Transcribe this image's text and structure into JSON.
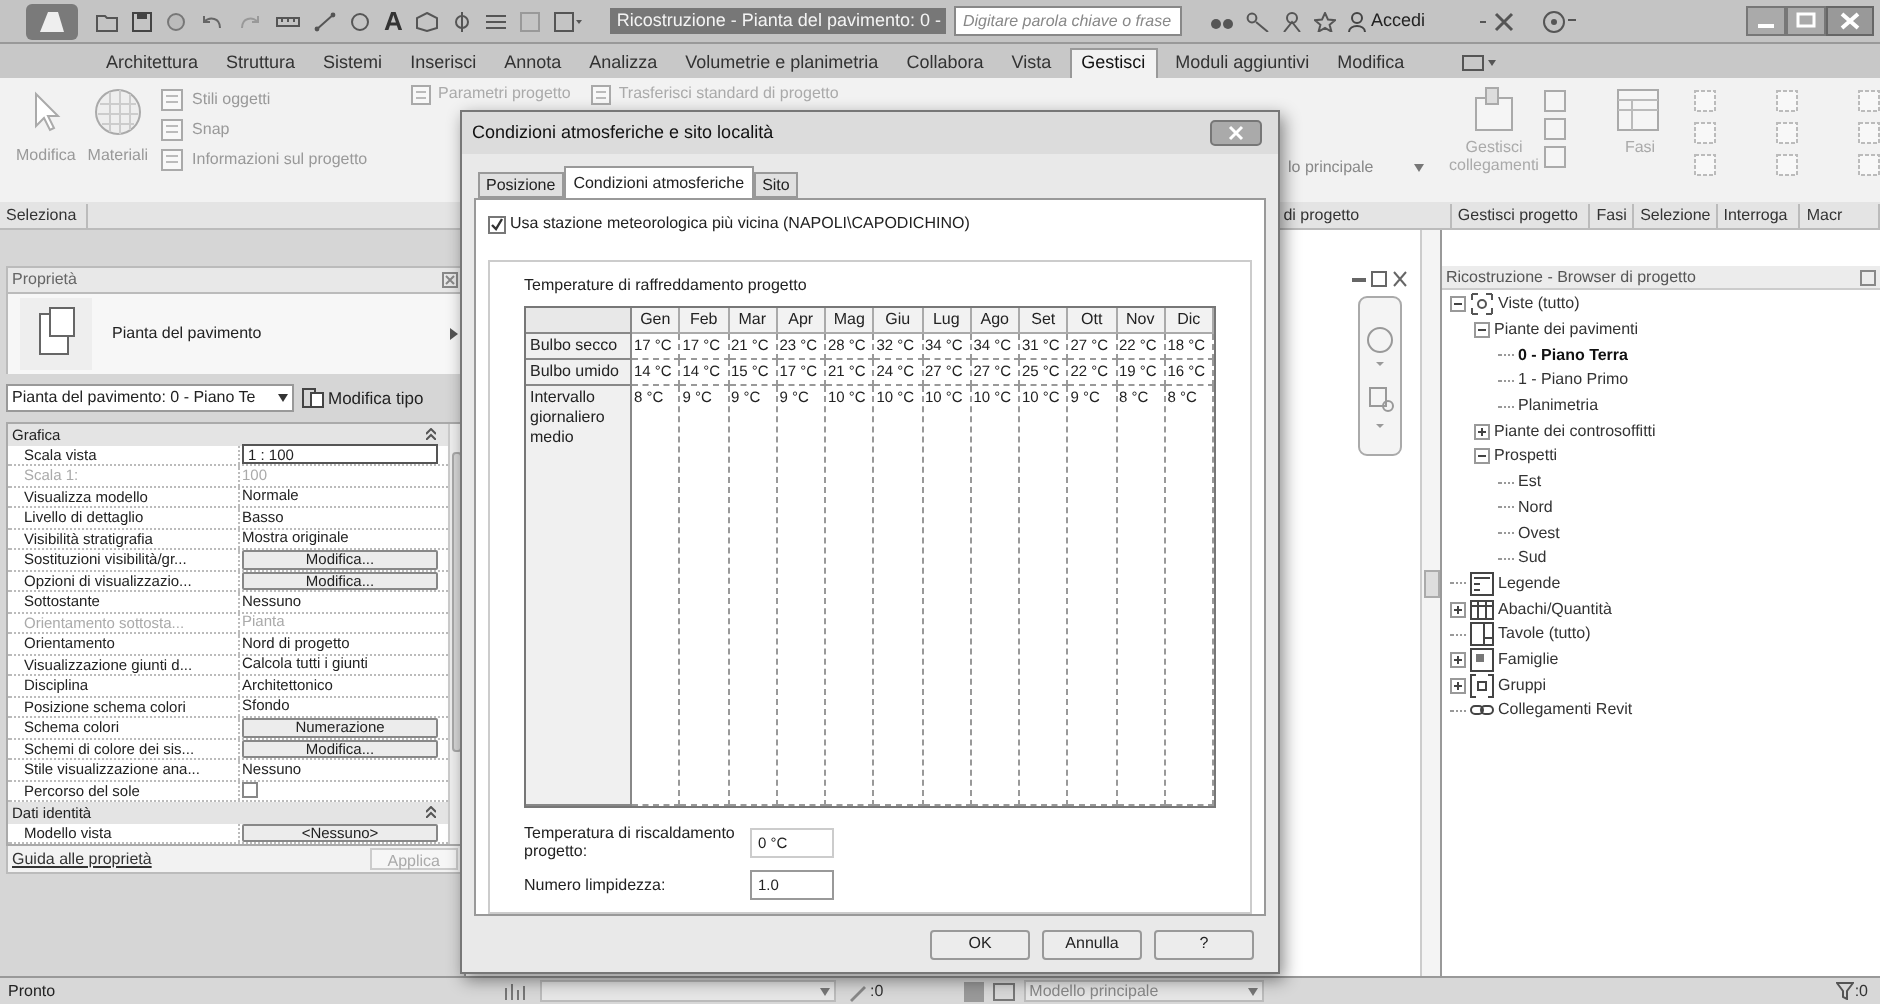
{
  "window": {
    "title": "Ricostruzione - Pianta del pavimento: 0 -"
  },
  "search": {
    "placeholder": "Digitare parola chiave o frase"
  },
  "sign_in": "Accedi",
  "quick_access": {
    "text_tool": "A"
  },
  "ribbon_tabs": [
    {
      "label": "Architettura",
      "selected": false
    },
    {
      "label": "Struttura",
      "selected": false
    },
    {
      "label": "Sistemi",
      "selected": false
    },
    {
      "label": "Inserisci",
      "selected": false
    },
    {
      "label": "Annota",
      "selected": false
    },
    {
      "label": "Analizza",
      "selected": false
    },
    {
      "label": "Volumetrie e planimetria",
      "selected": false
    },
    {
      "label": "Collabora",
      "selected": false
    },
    {
      "label": "Vista",
      "selected": false
    },
    {
      "label": "Gestisci",
      "selected": true
    },
    {
      "label": "Moduli aggiuntivi",
      "selected": false
    },
    {
      "label": "Modifica",
      "selected": false
    }
  ],
  "ribbon": {
    "large_buttons": [
      {
        "label": "Modifica",
        "kind": "select"
      },
      {
        "label": "Materiali",
        "kind": "materials"
      }
    ],
    "small_buttons": [
      "Stili oggetti",
      "Snap",
      "Informazioni sul progetto"
    ],
    "top_buttons": [
      "Parametri progetto",
      "Trasferisci standard di progetto"
    ],
    "dropdown": "lo principale",
    "right_buttons": [
      {
        "label": "Gestisci collegamenti",
        "kind": "links"
      },
      {
        "label": "Fasi",
        "kind": "phases"
      }
    ],
    "panel_label_left": "Seleziona",
    "panel_labels_right": [
      "di progetto",
      "Gestisci progetto",
      "Fasi",
      "Selezione",
      "Interroga",
      "Macr"
    ]
  },
  "properties": {
    "title": "Proprietà",
    "type_name": "Pianta del pavimento",
    "instance_selector": "Pianta del pavimento: 0 - Piano Te",
    "edit_type": "Modifica tipo",
    "groups": [
      {
        "label": "Grafica",
        "rows": [
          {
            "label": "Scala vista",
            "value": "1 : 100",
            "kind": "input",
            "disabled": false
          },
          {
            "label": "Scala 1:",
            "value": "100",
            "kind": "text",
            "disabled": true
          },
          {
            "label": "Visualizza modello",
            "value": "Normale",
            "kind": "text",
            "disabled": false
          },
          {
            "label": "Livello di dettaglio",
            "value": "Basso",
            "kind": "text",
            "disabled": false
          },
          {
            "label": "Visibilità stratigrafia",
            "value": "Mostra originale",
            "kind": "text",
            "disabled": false
          },
          {
            "label": "Sostituzioni visibilità/gr...",
            "value": "Modifica...",
            "kind": "button",
            "disabled": false
          },
          {
            "label": "Opzioni di visualizzazio...",
            "value": "Modifica...",
            "kind": "button",
            "disabled": false
          },
          {
            "label": "Sottostante",
            "value": "Nessuno",
            "kind": "text",
            "disabled": false
          },
          {
            "label": "Orientamento sottosta...",
            "value": "Pianta",
            "kind": "text",
            "disabled": true
          },
          {
            "label": "Orientamento",
            "value": "Nord di progetto",
            "kind": "text",
            "disabled": false
          },
          {
            "label": "Visualizzazione giunti d...",
            "value": "Calcola tutti i giunti",
            "kind": "text",
            "disabled": false
          },
          {
            "label": "Disciplina",
            "value": "Architettonico",
            "kind": "text",
            "disabled": false
          },
          {
            "label": "Posizione schema colori",
            "value": "Sfondo",
            "kind": "text",
            "disabled": false
          },
          {
            "label": "Schema colori",
            "value": "Numerazione",
            "kind": "button",
            "disabled": false
          },
          {
            "label": "Schemi di colore dei sis...",
            "value": "Modifica...",
            "kind": "button",
            "disabled": false
          },
          {
            "label": "Stile visualizzazione ana...",
            "value": "Nessuno",
            "kind": "text",
            "disabled": false
          },
          {
            "label": "Percorso del sole",
            "kind": "checkbox",
            "checked": false,
            "disabled": false
          }
        ]
      },
      {
        "label": "Dati identità",
        "rows": [
          {
            "label": "Modello vista",
            "value": "<Nessuno>",
            "kind": "button",
            "disabled": false
          }
        ]
      }
    ],
    "help_link": "Guida alle proprietà",
    "apply_button": {
      "label": "Applica",
      "disabled": true
    }
  },
  "browser": {
    "title": "Ricostruzione - Browser di progetto",
    "tree": [
      {
        "label": "Viste (tutto)",
        "kind": "views",
        "expanded": true,
        "selected": false,
        "children": [
          {
            "label": "Piante dei pavimenti",
            "expanded": true,
            "selected": false,
            "children": [
              {
                "label": "0 - Piano Terra",
                "selected": true
              },
              {
                "label": "1 - Piano Primo",
                "selected": false
              },
              {
                "label": "Planimetria",
                "selected": false
              }
            ]
          },
          {
            "label": "Piante dei controsoffitti",
            "expanded": false,
            "selected": false
          },
          {
            "label": "Prospetti",
            "expanded": true,
            "selected": false,
            "children": [
              {
                "label": "Est",
                "selected": false
              },
              {
                "label": "Nord",
                "selected": false
              },
              {
                "label": "Ovest",
                "selected": false
              },
              {
                "label": "Sud",
                "selected": false
              }
            ]
          }
        ]
      },
      {
        "label": "Legende",
        "kind": "legend",
        "selected": false
      },
      {
        "label": "Abachi/Quantità",
        "kind": "schedule",
        "expanded": false,
        "selected": false
      },
      {
        "label": "Tavole (tutto)",
        "kind": "sheet",
        "selected": false
      },
      {
        "label": "Famiglie",
        "kind": "family",
        "expanded": false,
        "selected": false
      },
      {
        "label": "Gruppi",
        "kind": "group",
        "expanded": false,
        "selected": false
      },
      {
        "label": "Collegamenti Revit",
        "kind": "link",
        "selected": false
      }
    ]
  },
  "dialog": {
    "title": "Condizioni atmosferiche e sito località",
    "tabs": [
      {
        "label": "Posizione",
        "selected": false
      },
      {
        "label": "Condizioni atmosferiche",
        "selected": true
      },
      {
        "label": "Sito",
        "selected": false
      }
    ],
    "nearest_station": {
      "label": "Usa stazione meteorologica più vicina (NAPOLI\\CAPODICHINO)",
      "checked": true
    },
    "cooling": {
      "title": "Temperature di raffreddamento progetto",
      "columns": [
        "Gen",
        "Feb",
        "Mar",
        "Apr",
        "Mag",
        "Giu",
        "Lug",
        "Ago",
        "Set",
        "Ott",
        "Nov",
        "Dic"
      ],
      "rows": [
        {
          "label": "Bulbo secco",
          "values": [
            "17 °C",
            "17 °C",
            "21 °C",
            "23 °C",
            "28 °C",
            "32 °C",
            "34 °C",
            "34 °C",
            "31 °C",
            "27 °C",
            "22 °C",
            "18 °C"
          ]
        },
        {
          "label": "Bulbo umido",
          "values": [
            "14 °C",
            "14 °C",
            "15 °C",
            "17 °C",
            "21 °C",
            "24 °C",
            "27 °C",
            "27 °C",
            "25 °C",
            "22 °C",
            "19 °C",
            "16 °C"
          ]
        },
        {
          "label": "Intervallo giornaliero medio",
          "values": [
            "8 °C",
            "9 °C",
            "9 °C",
            "9 °C",
            "10 °C",
            "10 °C",
            "10 °C",
            "10 °C",
            "10 °C",
            "9 °C",
            "8 °C",
            "8 °C"
          ]
        }
      ]
    },
    "heating": {
      "label": "Temperatura di riscaldamento progetto:",
      "value": "0 °C"
    },
    "clearness": {
      "label": "Numero limpidezza:",
      "value": "1.0"
    },
    "buttons": [
      "OK",
      "Annulla",
      "?"
    ]
  },
  "status_bar": {
    "message": "Pronto",
    "workset_count": ":0",
    "model": "Modello principale",
    "filter_count": ":0"
  }
}
